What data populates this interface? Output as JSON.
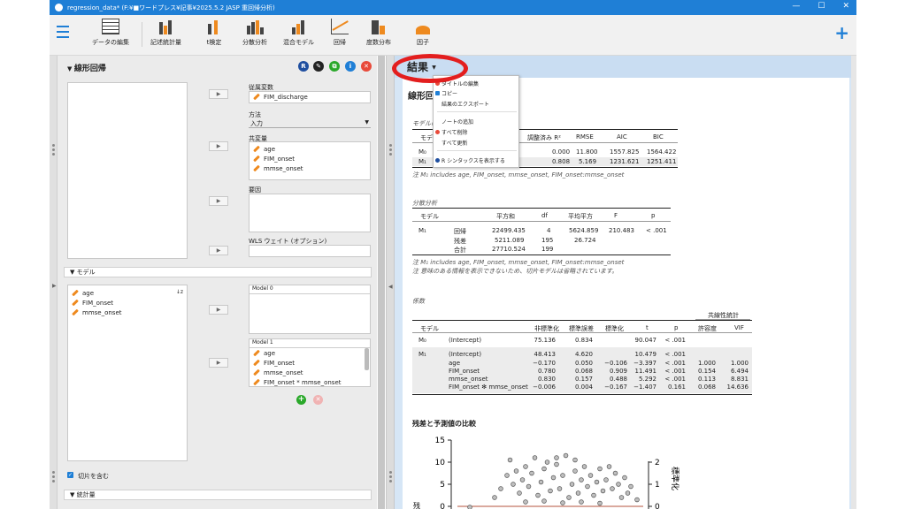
{
  "titlebar": {
    "title": "regression_data*   (F:¥■ワードプレス¥記事¥2025.5.2  JASP  重回帰分析)",
    "min": "—",
    "max": "☐",
    "close": "✕"
  },
  "toolbar": {
    "items": [
      {
        "label": "データの編集"
      },
      {
        "label": "記述統計量"
      },
      {
        "label": "t検定"
      },
      {
        "label": "分散分析"
      },
      {
        "label": "混合モデル"
      },
      {
        "label": "回帰"
      },
      {
        "label": "度数分布"
      },
      {
        "label": "因子"
      }
    ],
    "plus": "+"
  },
  "analysis": {
    "title": "線形回帰",
    "icons": {
      "r": "R",
      "edit": "✎",
      "copy": "⧉",
      "info": "i",
      "close": "✕"
    },
    "dependent_label": "従属変数",
    "dependent_value": "FIM_discharge",
    "method_label": "方法",
    "method_value": "入力",
    "covariates_label": "共変量",
    "covariates": [
      "age",
      "FIM_onset",
      "mmse_onset"
    ],
    "factors_label": "要因",
    "wls_label": "WLS ウェイト (オプション)",
    "model_section": "▼ モデル",
    "model_vars": [
      "age",
      "FIM_onset",
      "mmse_onset"
    ],
    "model0_label": "Model 0",
    "model1_label": "Model 1",
    "model1_terms": [
      "age",
      "FIM_onset",
      "mmse_onset",
      "FIM_onset * mmse_onset"
    ],
    "intercept_label": "切片を含む",
    "stats_section": "▼ 統計量"
  },
  "results": {
    "header": "結果",
    "caret": "▼",
    "doc_title": "線形回",
    "model_summary_label": "モデルの",
    "model_col": "モデ",
    "summary_headers": [
      "調整済み R²",
      "RMSE",
      "AIC",
      "BIC"
    ],
    "summary_rows": [
      {
        "model": "M₀",
        "adjr2": "0.000",
        "rmse": "11.800",
        "aic": "1557.825",
        "bic": "1564.422"
      },
      {
        "model": "M₁",
        "adjr2": "0.808",
        "rmse": "5.169",
        "aic": "1231.621",
        "bic": "1251.411"
      }
    ],
    "summary_note": "注 M₁ includes age, FIM_onset, mmse_onset, FIM_onset:mmse_onset",
    "anova_label": "分散分析",
    "anova_headers": [
      "モデル",
      "平方和",
      "df",
      "平均平方",
      "F",
      "p"
    ],
    "anova_rows": [
      {
        "model": "M₁",
        "term": "回帰",
        "ss": "22499.435",
        "df": "4",
        "ms": "5624.859",
        "f": "210.483",
        "p": "< .001"
      },
      {
        "model": "",
        "term": "残差",
        "ss": "5211.089",
        "df": "195",
        "ms": "26.724",
        "f": "",
        "p": ""
      },
      {
        "model": "",
        "term": "合計",
        "ss": "27710.524",
        "df": "199",
        "ms": "",
        "f": "",
        "p": ""
      }
    ],
    "anova_note1": "注 M₁ includes age, FIM_onset, mmse_onset, FIM_onset:mmse_onset",
    "anova_note2": "注 意味のある情報を表示できないため、切片モデルは省略されています。",
    "coef_label": "係数",
    "collinearity_header": "共線性統計",
    "coef_headers": [
      "モデル",
      "非標準化",
      "標準誤差",
      "標準化",
      "t",
      "p",
      "許容度",
      "VIF"
    ],
    "coef_rows": [
      {
        "model": "M₀",
        "term": "(Intercept)",
        "b": "75.136",
        "se": "0.834",
        "beta": "",
        "t": "90.047",
        "p": "< .001",
        "tol": "",
        "vif": ""
      },
      {
        "model": "M₁",
        "term": "(Intercept)",
        "b": "48.413",
        "se": "4.620",
        "beta": "",
        "t": "10.479",
        "p": "< .001",
        "tol": "",
        "vif": ""
      },
      {
        "model": "",
        "term": "age",
        "b": "−0.170",
        "se": "0.050",
        "beta": "−0.106",
        "t": "−3.397",
        "p": "< .001",
        "tol": "1.000",
        "vif": "1.000"
      },
      {
        "model": "",
        "term": "FIM_onset",
        "b": "0.780",
        "se": "0.068",
        "beta": "0.909",
        "t": "11.491",
        "p": "< .001",
        "tol": "0.154",
        "vif": "6.494"
      },
      {
        "model": "",
        "term": "mmse_onset",
        "b": "0.830",
        "se": "0.157",
        "beta": "0.488",
        "t": "5.292",
        "p": "< .001",
        "tol": "0.113",
        "vif": "8.831"
      },
      {
        "model": "",
        "term": "FIM_onset ✻ mmse_onset",
        "b": "−0.006",
        "se": "0.004",
        "beta": "−0.167",
        "t": "−1.407",
        "p": "0.161",
        "tol": "0.068",
        "vif": "14.636"
      }
    ]
  },
  "context_menu": {
    "items": [
      "タイトルの編集",
      "コピー",
      "結果のエクスポート",
      "ノートの追加",
      "すべて削除",
      "すべて更新",
      "R シンタックスを表示する"
    ],
    "colors": {
      "edit": "#e84a3a",
      "copy": "#1f7fd6",
      "delete": "#e84a3a",
      "r": "#1f4fa0"
    }
  },
  "chart_data": {
    "type": "scatter",
    "title": "残差と予測値の比較",
    "yticks": [
      "15",
      "10",
      "5",
      "0"
    ],
    "y2ticks": [
      "2",
      "1",
      "0"
    ],
    "ylabel_partial": "残",
    "y2label_partial": "標準化",
    "ylim": [
      0,
      15
    ],
    "points": [
      [
        2,
        -0.2
      ],
      [
        6,
        2
      ],
      [
        7,
        4
      ],
      [
        8,
        7
      ],
      [
        8.5,
        10.5
      ],
      [
        9,
        5
      ],
      [
        9.5,
        8
      ],
      [
        10,
        3
      ],
      [
        10.5,
        6
      ],
      [
        11,
        9
      ],
      [
        11.5,
        4.5
      ],
      [
        12,
        7.5
      ],
      [
        12.5,
        11
      ],
      [
        13,
        2.5
      ],
      [
        13.5,
        5.5
      ],
      [
        14,
        8.5
      ],
      [
        14.5,
        10
      ],
      [
        15,
        3.5
      ],
      [
        15.5,
        6.5
      ],
      [
        16,
        9.5
      ],
      [
        16.5,
        4
      ],
      [
        17,
        7
      ],
      [
        17.5,
        11.5
      ],
      [
        18,
        2
      ],
      [
        18.5,
        5
      ],
      [
        19,
        8
      ],
      [
        19.5,
        3
      ],
      [
        20,
        6
      ],
      [
        20.5,
        9
      ],
      [
        21,
        4.5
      ],
      [
        21.5,
        7
      ],
      [
        22,
        2.5
      ],
      [
        22.5,
        5.5
      ],
      [
        23,
        8.5
      ],
      [
        23.5,
        3.5
      ],
      [
        24,
        6
      ],
      [
        24.5,
        9
      ],
      [
        25,
        4
      ],
      [
        25.5,
        7.5
      ],
      [
        26,
        5
      ],
      [
        26.5,
        2
      ],
      [
        27,
        6.5
      ],
      [
        27.5,
        3
      ],
      [
        28,
        4.5
      ],
      [
        29,
        1.5
      ],
      [
        11,
        1
      ],
      [
        14,
        1.2
      ],
      [
        17,
        0.8
      ],
      [
        20,
        1
      ],
      [
        23,
        0.7
      ],
      [
        16,
        11
      ],
      [
        19,
        10.5
      ]
    ]
  }
}
